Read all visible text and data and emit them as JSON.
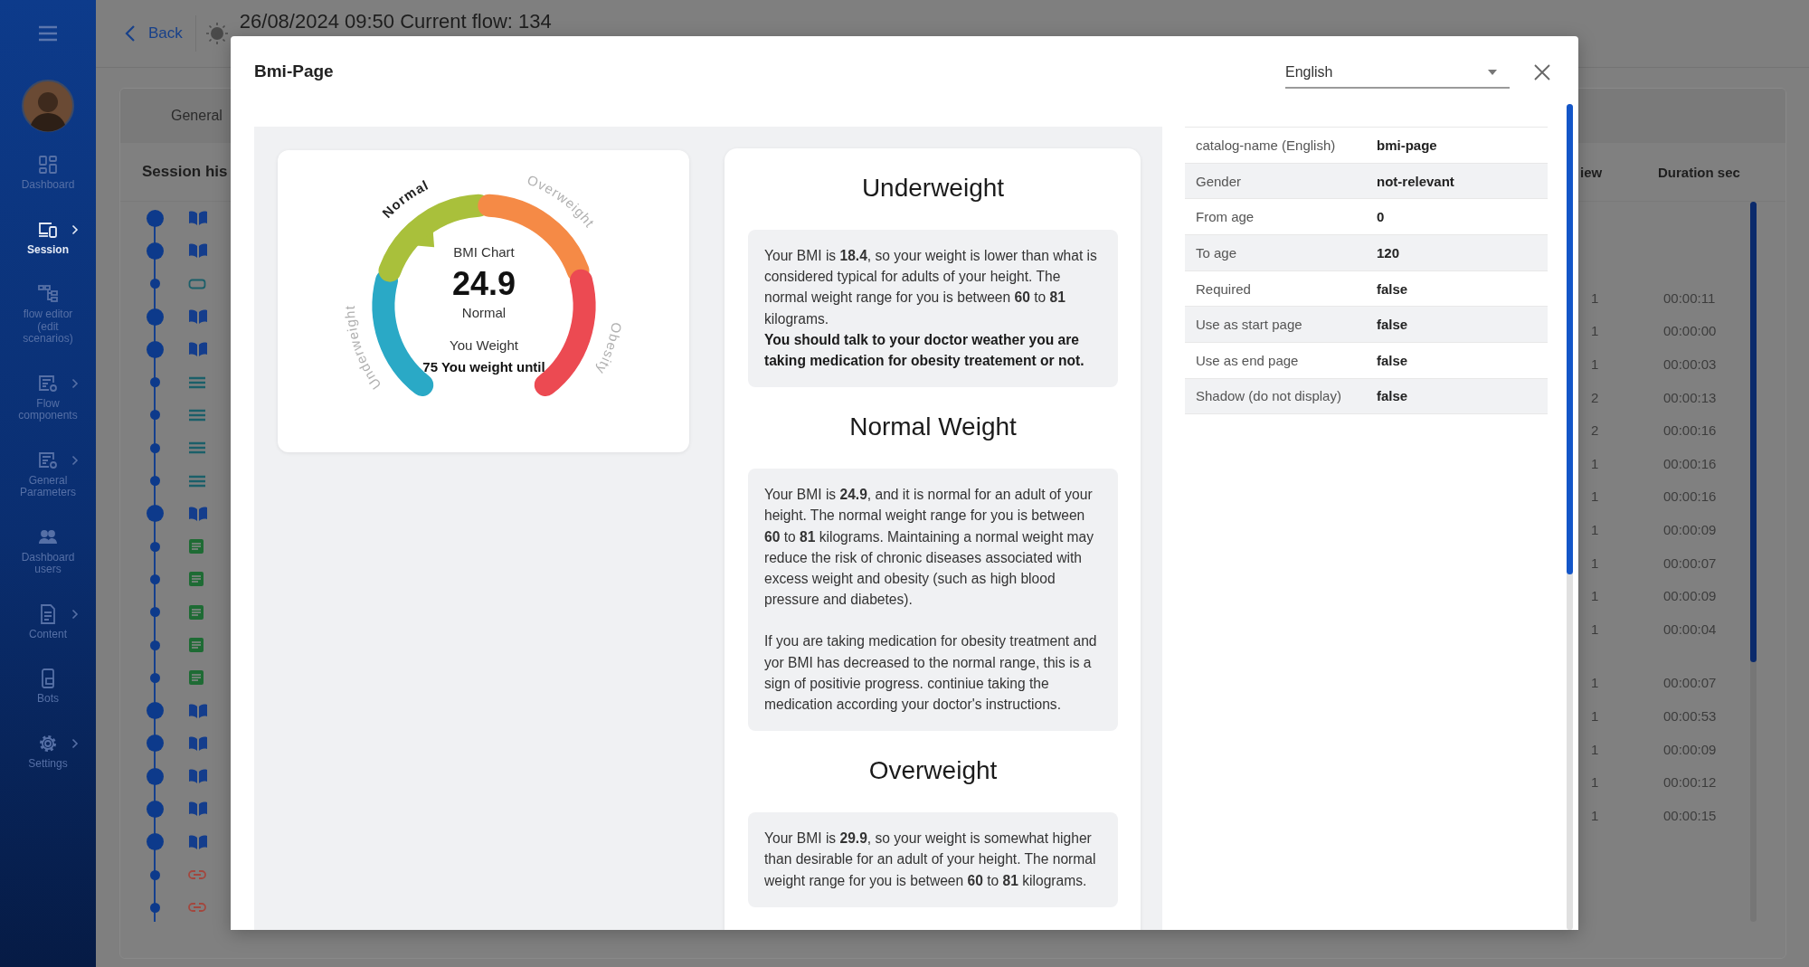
{
  "sidebar": {
    "items": [
      {
        "label": "Dashboard",
        "selected": false,
        "expandable": false
      },
      {
        "label": "Session",
        "selected": true,
        "expandable": true
      },
      {
        "label": "flow editor (edit scenarios)",
        "selected": false,
        "expandable": false
      },
      {
        "label": "Flow components",
        "selected": false,
        "expandable": true
      },
      {
        "label": "General Parameters",
        "selected": false,
        "expandable": true
      },
      {
        "label": "Dashboard users",
        "selected": false,
        "expandable": false
      },
      {
        "label": "Content",
        "selected": false,
        "expandable": true
      },
      {
        "label": "Bots",
        "selected": false,
        "expandable": false
      },
      {
        "label": "Settings",
        "selected": false,
        "expandable": true
      }
    ]
  },
  "top_bar": {
    "back": "Back",
    "title": "26/08/2024 09:50  Current flow: 134"
  },
  "tab": "General",
  "session_history": {
    "title": "Session his",
    "timeline": [
      {
        "kind": "book"
      },
      {
        "kind": "book"
      },
      {
        "kind": "screen"
      },
      {
        "kind": "book"
      },
      {
        "kind": "book"
      },
      {
        "kind": "list"
      },
      {
        "kind": "list"
      },
      {
        "kind": "list"
      },
      {
        "kind": "list"
      },
      {
        "kind": "book"
      },
      {
        "kind": "document"
      },
      {
        "kind": "document"
      },
      {
        "kind": "document"
      },
      {
        "kind": "document"
      },
      {
        "kind": "document"
      },
      {
        "kind": "book"
      },
      {
        "kind": "book"
      },
      {
        "kind": "book"
      },
      {
        "kind": "book"
      },
      {
        "kind": "book"
      },
      {
        "kind": "link"
      },
      {
        "kind": "link"
      }
    ],
    "columns": [
      "iew",
      "Duration sec"
    ],
    "rows": [
      {
        "kind": "entry",
        "column_1": "1",
        "duration": "00:00:11"
      },
      {
        "kind": "entry",
        "column_1": "1",
        "duration": "00:00:00"
      },
      {
        "kind": "entry",
        "column_1": "1",
        "duration": "00:00:03"
      },
      {
        "kind": "entry",
        "column_1": "2",
        "duration": "00:00:13"
      },
      {
        "kind": "entry",
        "column_1": "2",
        "duration": "00:00:16"
      },
      {
        "kind": "entry",
        "column_1": "1",
        "duration": "00:00:16"
      },
      {
        "kind": "entry",
        "column_1": "1",
        "duration": "00:00:16"
      },
      {
        "kind": "entry",
        "column_1": "1",
        "duration": "00:00:09"
      },
      {
        "kind": "entry",
        "column_1": "1",
        "duration": "00:00:07"
      },
      {
        "kind": "entry",
        "column_1": "1",
        "duration": "00:00:09"
      },
      {
        "kind": "entry",
        "column_1": "1",
        "duration": "00:00:04"
      },
      {
        "kind": "empty"
      },
      {
        "kind": "entry",
        "column_1": "1",
        "duration": "00:00:07"
      },
      {
        "kind": "entry",
        "column_1": "1",
        "duration": "00:00:53"
      },
      {
        "kind": "entry",
        "column_1": "1",
        "duration": "00:00:09"
      },
      {
        "kind": "entry",
        "column_1": "1",
        "duration": "00:00:12"
      },
      {
        "kind": "entry",
        "column_1": "1",
        "duration": "00:00:15"
      }
    ]
  },
  "dialog": {
    "title": "Bmi-Page",
    "language": "English",
    "gauge": {
      "title": "BMI Chart",
      "value": "24.9",
      "category": "Normal",
      "weight_label": "You Weight",
      "weight_text": "75 You weight until",
      "segments": [
        {
          "label": "Underweight",
          "color": "#2aa9c6",
          "selected": false
        },
        {
          "label": "Normal",
          "color": "#a9c03b",
          "selected": true
        },
        {
          "label": "Overweight",
          "color": "#f58a46",
          "selected": false
        },
        {
          "label": "Obesity",
          "color": "#ec4a52",
          "selected": false
        }
      ]
    },
    "sections": [
      {
        "heading": "Underweight",
        "paragraphs": [
          {
            "text": "Your BMI is **18.4**, so your weight is lower than what is considered typical for adults of your height. The normal weight range for you is between **60** to **81** kilograms.",
            "emphasis": false
          },
          {
            "text": "You should talk to your doctor weather you are taking medication for obesity treatement or not.",
            "emphasis": true
          }
        ]
      },
      {
        "heading": "Normal Weight",
        "paragraphs": [
          {
            "text": "Your BMI is **24.9**, and it is normal for an adult of your height. The normal weight range for you is between **60** to **81** kilograms. Maintaining a normal weight may reduce the risk of chronic diseases associated with excess weight and obesity (such as high blood pressure and diabetes).",
            "emphasis": false
          },
          {
            "text": "If you are taking medication for obesity treatment and yor BMI has decreased to the normal range, this is a sign of positivie progress. continiue taking the medication according your doctor's instructions.",
            "emphasis": false
          }
        ]
      },
      {
        "heading": "Overweight",
        "paragraphs": [
          {
            "text": "Your BMI is **29.9**, so your weight is somewhat higher than desirable for an adult of your height. The normal weight range for you is between **60** to **81** kilograms.",
            "emphasis": false
          }
        ]
      }
    ],
    "properties": [
      {
        "label": "catalog-name (English)",
        "value": "bmi-page"
      },
      {
        "label": "Gender",
        "value": "not-relevant"
      },
      {
        "label": "From age",
        "value": "0"
      },
      {
        "label": "To age",
        "value": "120"
      },
      {
        "label": "Required",
        "value": "false"
      },
      {
        "label": "Use as start page",
        "value": "false"
      },
      {
        "label": "Use as end page",
        "value": "false"
      },
      {
        "label": "Shadow (do not display)",
        "value": "false"
      }
    ]
  }
}
